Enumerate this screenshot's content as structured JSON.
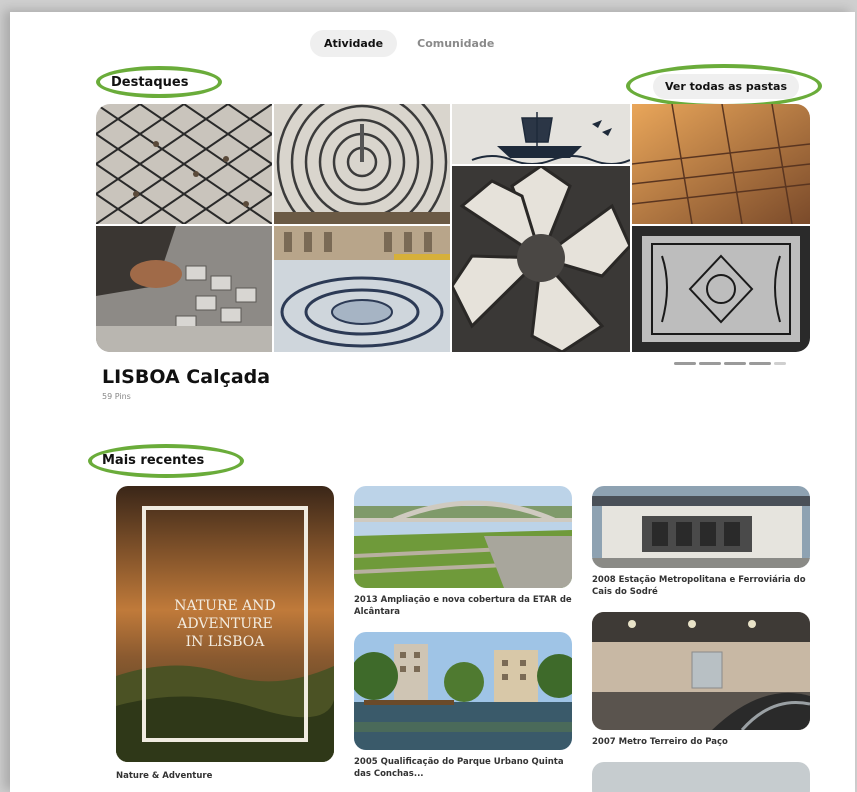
{
  "tabs": [
    {
      "label": "Atividade",
      "active": true
    },
    {
      "label": "Comunidade",
      "active": false
    }
  ],
  "highlights": {
    "title": "Destaques",
    "see_all_label": "Ver todas as pastas",
    "board": {
      "name": "LISBOA Calçada",
      "pins": "59 Pins"
    },
    "pager_dots": 5
  },
  "recent": {
    "title": "Mais recentes",
    "pins": [
      {
        "caption": "Nature & Adventure",
        "overlay_text": "NATURE AND ADVENTURE IN LISBOA"
      },
      {
        "caption": "2013 Ampliação e nova cobertura da ETAR de Alcântara"
      },
      {
        "caption": "2005 Qualificação do Parque Urbano Quinta das Conchas..."
      },
      {
        "caption": "2008 Estação Metropolitana e Ferroviária do Cais do Sodré"
      },
      {
        "caption": "2007 Metro Terreiro do Paço"
      }
    ]
  },
  "colors": {
    "highlight_ring": "#6aac3a",
    "tab_active_bg": "#efefef"
  }
}
